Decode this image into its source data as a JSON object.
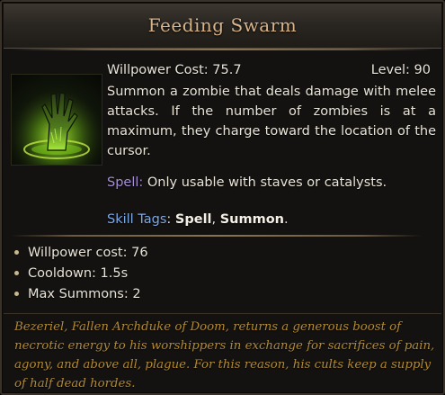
{
  "tooltip": {
    "title": "Feeding Swarm",
    "willpower_cost_label": "Willpower Cost: 75.7",
    "level_label": "Level: 90",
    "description": "Summon a zombie that deals damage with melee attacks. If the number of zombies is at a maximum, they charge toward the location of the cursor.",
    "spell": {
      "key": "Spell:",
      "text": " Only usable with staves or catalysts."
    },
    "skill_tags": {
      "key": "Skill Tags",
      "sep": ": ",
      "tag1": "Spell",
      "comma": ", ",
      "tag2": "Summon",
      "end": "."
    },
    "stats": [
      "Willpower cost: 76",
      "Cooldown: 1.5s",
      "Max Summons: 2"
    ],
    "lore": "Bezeriel, Fallen Archduke of Doom, returns a generous boost of necrotic energy to his worshippers in exchange for sacrifices of pain, agony, and above all, plague. For this reason, his cults keep a supply of half dead hordes.",
    "icon": "zombie-hand-rising-from-green-portal-icon"
  },
  "colors": {
    "title": "#d8b48a",
    "spell_key": "#a48fd3",
    "tags_key": "#7da8e6",
    "lore": "#b28a34"
  }
}
